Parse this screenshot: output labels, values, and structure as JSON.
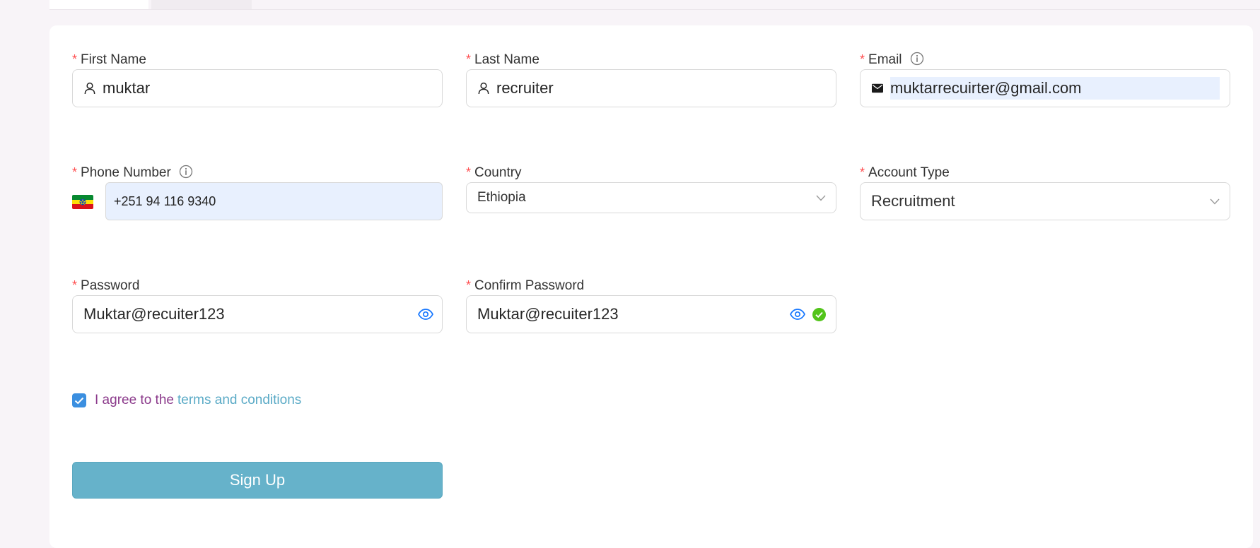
{
  "form": {
    "first_name": {
      "label": "First Name",
      "value": "muktar",
      "icon": "user-icon"
    },
    "last_name": {
      "label": "Last Name",
      "value": "recruiter",
      "icon": "user-icon"
    },
    "email": {
      "label": "Email",
      "value": "muktarrecuirter@gmail.com",
      "icon": "mail-icon"
    },
    "phone": {
      "label": "Phone Number",
      "value": "+251 94 116 9340",
      "flag": "ethiopia-flag-icon"
    },
    "country": {
      "label": "Country",
      "value": "Ethiopia"
    },
    "account_type": {
      "label": "Account Type",
      "value": "Recruitment"
    },
    "password": {
      "label": "Password",
      "value": "Muktar@recuiter123"
    },
    "confirm_password": {
      "label": "Confirm Password",
      "value": "Muktar@recuiter123"
    },
    "required_marker": "*",
    "agree": {
      "text": "I agree to the",
      "link": "terms and conditions",
      "checked": true
    },
    "submit_label": "Sign Up"
  },
  "colors": {
    "required": "#ff4d4f",
    "checkbox": "#3b8fe0",
    "link": "#5aaac6",
    "agree_text": "#8b3a8b",
    "button": "#66b2ca",
    "success": "#52c41a",
    "eye": "#1677ff"
  }
}
